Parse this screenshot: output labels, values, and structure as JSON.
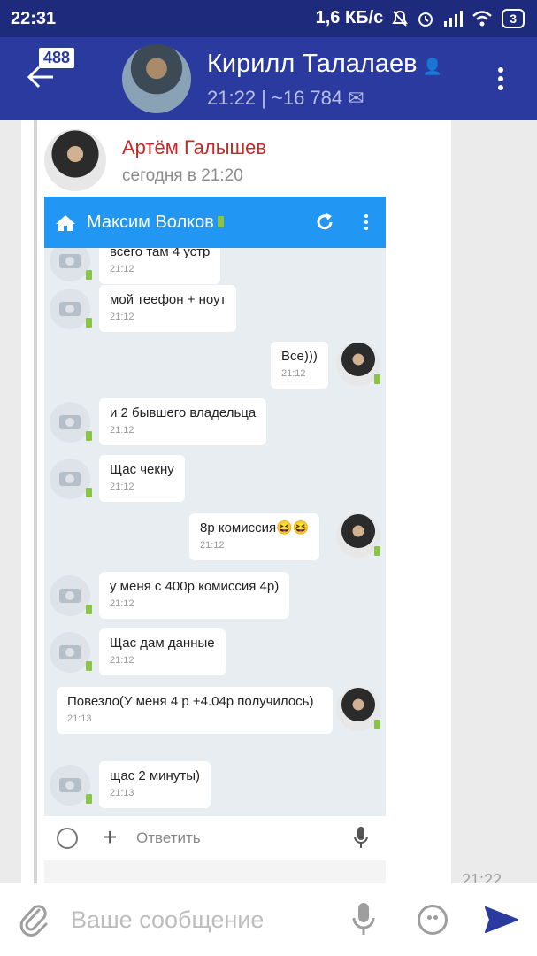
{
  "status_bar": {
    "time": "22:31",
    "network_speed": "1,6 КБ/с",
    "battery": "3"
  },
  "header": {
    "unread_count": "488",
    "title": "Кирилл Талалаев",
    "subtitle": "21:22 | ~16 784 ✉"
  },
  "message": {
    "sender_name": "Артём Галышев",
    "sender_time": "сегодня в 21:20",
    "time": "21:22"
  },
  "screenshot": {
    "header_title": "Максим Волков",
    "input_placeholder": "Ответить",
    "messages": [
      {
        "side": "in",
        "text": "всего там 4 устр",
        "time": "21:12"
      },
      {
        "side": "in",
        "text": "мой теефон + ноут",
        "time": "21:12"
      },
      {
        "side": "out",
        "text": "Все)))",
        "time": "21:12"
      },
      {
        "side": "in",
        "text": "и 2 бывшего владельца",
        "time": "21:12"
      },
      {
        "side": "in",
        "text": "Щас чекну",
        "time": "21:12"
      },
      {
        "side": "out",
        "text": "8р комиссия😆😆",
        "time": "21:12"
      },
      {
        "side": "in",
        "text": "у меня с 400р комиссия 4р)",
        "time": "21:12"
      },
      {
        "side": "in",
        "text": "Щас дам данные",
        "time": "21:12"
      },
      {
        "side": "out",
        "text": "Повезло(У меня 4 р +4.04р получилось)",
        "time": "21:13"
      },
      {
        "side": "in",
        "text": "щас 2 минуты)",
        "time": "21:13"
      }
    ]
  },
  "composer": {
    "placeholder": "Ваше сообщение"
  },
  "colors": {
    "status_bar": "#1e2a7b",
    "app_bar": "#2a3a9e",
    "sender_name": "#c62828",
    "screenshot_header": "#2196f3",
    "send_icon": "#2a3a9e"
  }
}
